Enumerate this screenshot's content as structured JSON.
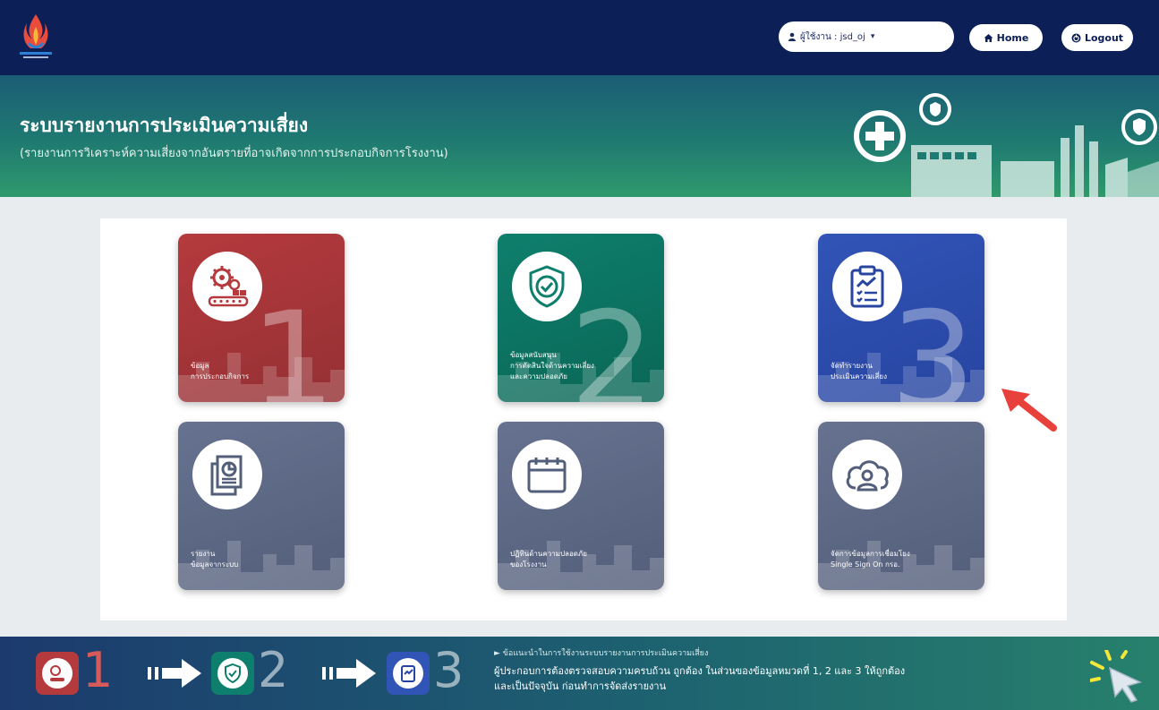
{
  "header": {
    "user_menu_label": "ผู้ใช้งาน : jsd_oj",
    "user_icon": "user-icon",
    "home_label": "Home",
    "home_icon": "home-icon",
    "logout_label": "Logout",
    "logout_icon": "power-icon"
  },
  "hero": {
    "title": "ระบบรายงานการประเมินความเสี่ยง",
    "subtitle": "(รายงานการวิเคราะห์ความเสี่ยงจากอันตรายที่อาจเกิดจากการประกอบกิจการโรงงาน)"
  },
  "tiles": [
    {
      "number": "1",
      "line1": "ข้อมูล",
      "line2": "การประกอบกิจการ",
      "line3": "",
      "icon": "factory-gear-icon"
    },
    {
      "number": "2",
      "line1": "ข้อมูลสนับสนุน",
      "line2": "การตัดสินใจด้านความเสี่ยง",
      "line3": "และความปลอดภัย",
      "icon": "shield-check-icon"
    },
    {
      "number": "3",
      "line1": "จัดทำรายงาน",
      "line2": "ประเมินความเสี่ยง",
      "line3": "",
      "icon": "clipboard-chart-icon"
    },
    {
      "number": "",
      "line1": "รายงาน",
      "line2": "ข้อมูลจากระบบ",
      "line3": "",
      "icon": "report-pie-icon"
    },
    {
      "number": "",
      "line1": "ปฏิทินด้านความปลอดภัย",
      "line2": "ของโรงงาน",
      "line3": "",
      "icon": "calendar-icon"
    },
    {
      "number": "",
      "line1": "จัดการข้อมูลการเชื่อมโยง",
      "line2": "Single Sign On กรอ.",
      "line3": "",
      "icon": "cloud-user-icon"
    }
  ],
  "footer": {
    "steps": [
      "1",
      "2",
      "3"
    ],
    "info_heading": "► ข้อแนะนำในการใช้งานระบบรายงานการประเมินความเสี่ยง",
    "info_line1": "ผู้ประกอบการต้องตรวจสอบความครบถ้วน ถูกต้อง ในส่วนของข้อมูลหมวดที่ 1, 2 และ 3 ให้ถูกต้อง",
    "info_line2": "และเป็นปัจจุบัน ก่อนทำการจัดส่งรายงาน"
  },
  "colors": {
    "navbar": "#0c1f57",
    "tile1": "#b53a3d",
    "tile2": "#0e7f6c",
    "tile3": "#3154b7",
    "tile_gray": "#66728f",
    "arrow": "#e8413c"
  }
}
